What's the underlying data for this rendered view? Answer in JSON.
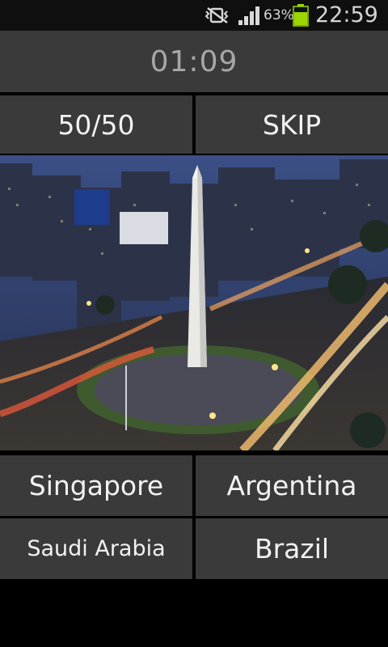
{
  "status_bar": {
    "battery_percent": "63%",
    "time": "22:59",
    "icons": [
      "mute-vibrate-icon",
      "signal-strength-icon",
      "battery-icon"
    ],
    "battery_color": "#9bd600"
  },
  "timer": {
    "value": "01:09"
  },
  "lifelines": {
    "fifty_fifty_label": "50/50",
    "skip_label": "SKIP"
  },
  "question_image": {
    "subject": "city-landmark-photo"
  },
  "answers": [
    {
      "label": "Singapore"
    },
    {
      "label": "Argentina"
    },
    {
      "label": "Saudi Arabia"
    },
    {
      "label": "Brazil"
    }
  ],
  "colors": {
    "button_bg": "#3a3a3a",
    "timer_text": "#a7a7a7",
    "button_text": "#f2f2f2"
  }
}
